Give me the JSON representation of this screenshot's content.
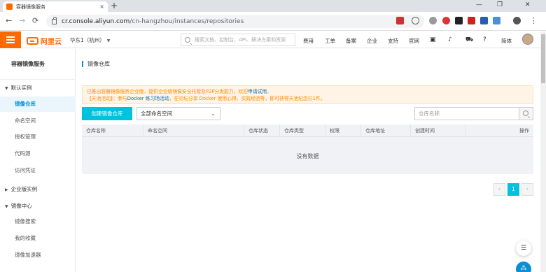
{
  "browser": {
    "tab_title": "容器镜像服务",
    "tab_close": "×",
    "new_tab": "+",
    "url_host": "cr.console.aliyun.com",
    "url_path": "/cn-hangzhou/instances/repositories",
    "back": "←",
    "forward": "→",
    "reload": "⟳",
    "minimize": "—",
    "restore": "❐",
    "close": "✕"
  },
  "topnav": {
    "logo_text": "阿里云",
    "region": "华东1（杭州）",
    "search_placeholder": "搜索文档、控制台、API、解决方案和资源",
    "links": [
      "费用",
      "工单",
      "备案",
      "企业",
      "支持",
      "官网"
    ],
    "language": "简体",
    "icons": [
      "terminal-icon",
      "bell-icon",
      "cart-icon",
      "help-icon"
    ]
  },
  "sidebar": {
    "title": "容器镜像服务",
    "groups": [
      {
        "label": "默认实例",
        "expanded": true,
        "items": [
          "镜像仓库",
          "命名空间",
          "授权管理",
          "代码源",
          "访问凭证"
        ]
      },
      {
        "label": "企业版实例",
        "expanded": false,
        "items": []
      },
      {
        "label": "镜像中心",
        "expanded": true,
        "items": [
          "镜像搜索",
          "我的收藏",
          "镜像加速器"
        ]
      }
    ],
    "active_item": "镜像仓库"
  },
  "main": {
    "title": "镜像仓库",
    "notice_line1_prefix": "已推出容器镜像服务企业版，提供企业级镜像安全托管及P2P分发能力，欢迎",
    "notice_line1_link": "申请试用",
    "notice_line1_suffix": "。",
    "notice_line2_prefix": "【天池活动】：参与",
    "notice_line2_link": "Docker 练习场活动",
    "notice_line2_suffix": "，在论坛分享 Docker 使用心得、实践经验等，即可获得天池纪念衫1件。",
    "create_button": "创建镜像仓库",
    "namespace_select": "全部命名空间",
    "repo_search_placeholder": "仓库名称",
    "table_headers": [
      "仓库名称",
      "命名空间",
      "仓库状态",
      "仓库类型",
      "权限",
      "仓库地址",
      "创建时间",
      "操作"
    ],
    "empty_text": "没有数据",
    "pagination": {
      "prev": "‹",
      "current": "1",
      "next": "›"
    }
  },
  "colors": {
    "brand_orange": "#ff6a00",
    "accent_cyan": "#00c1de",
    "active_blue": "#0a8fd6",
    "notice_text": "#ff8a00"
  }
}
